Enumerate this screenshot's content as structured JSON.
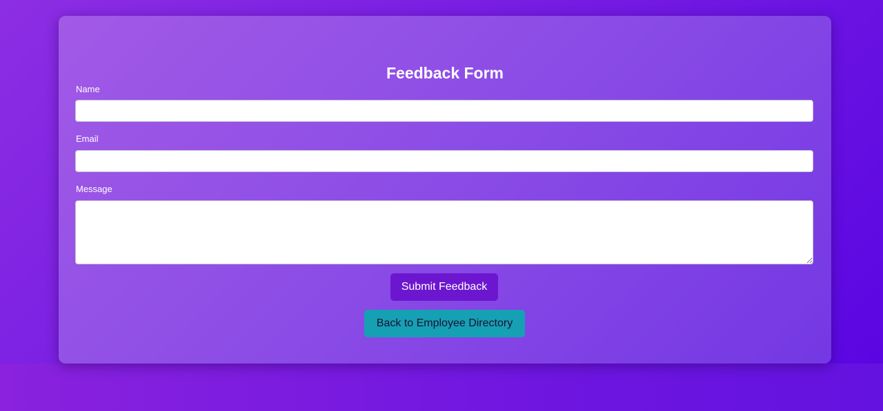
{
  "form": {
    "title": "Feedback Form",
    "name_label": "Name",
    "name_value": "",
    "email_label": "Email",
    "email_value": "",
    "message_label": "Message",
    "message_value": "",
    "submit_label": "Submit Feedback",
    "back_label": "Back to Employee Directory"
  },
  "colors": {
    "background_start": "#8e2de2",
    "background_end": "#4a00e0",
    "card_tint": "#9b55e6",
    "submit_button": "#6c17cf",
    "back_button": "#16a0b4"
  }
}
